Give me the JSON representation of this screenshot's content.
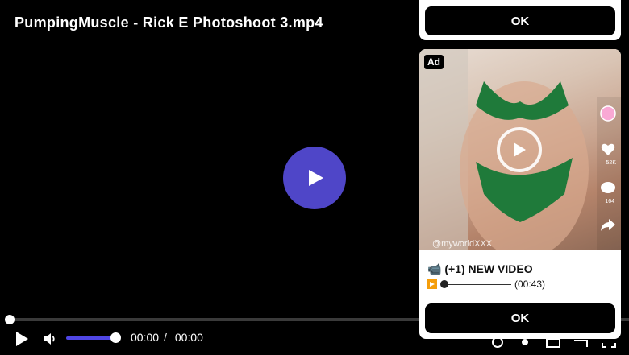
{
  "video": {
    "title": "PumpingMuscle - Rick E Photoshoot 3.mp4",
    "current_time": "00:00",
    "separator": "/",
    "duration": "00:00",
    "progress": 0,
    "volume": 1.0
  },
  "colors": {
    "accent": "#4f46c8",
    "volume_track": "#4f46e5"
  },
  "ad": {
    "badge": "Ad",
    "watermark": "@myworldXXX",
    "heading": "📹 (+1) NEW VIDEO",
    "sub_duration": "(00:43)",
    "ok_label": "OK",
    "side_counts": [
      "52K",
      "164"
    ]
  },
  "top_card": {
    "ok_label": "OK"
  },
  "icons": [
    "play-icon",
    "volume-icon",
    "captions-icon",
    "settings-icon",
    "pip-icon",
    "cast-icon",
    "fullscreen-icon"
  ]
}
